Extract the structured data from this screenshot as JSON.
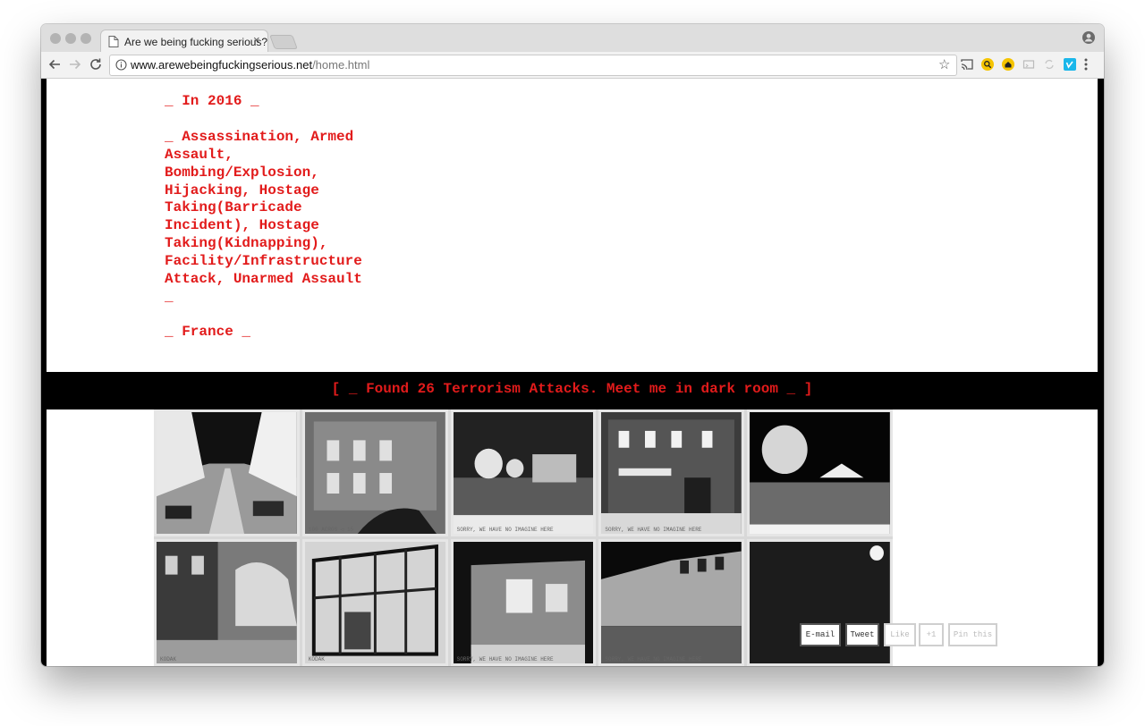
{
  "browser": {
    "tab_title": "Are we being fucking serious?",
    "tab_close": "×",
    "url_domain": "www.arewebeingfuckingserious.net",
    "url_path": "/home.html"
  },
  "page": {
    "year_line": "_ In 2016 _",
    "attack_types": "_ Assassination, Armed Assault, Bombing/Explosion, Hijacking, Hostage Taking(Barricade Incident), Hostage Taking(Kidnapping), Facility/Infrastructure Attack, Unarmed Assault _",
    "country_line": "_ France _",
    "banner": "[ _ Found 26 Terrorism Attacks. Meet me in dark room _ ]",
    "accent_color": "#e21b1b"
  },
  "gallery": {
    "captions": [
      "100 ACROS ◁ 15",
      "SORRY, WE HAVE NO IMAGINE HERE",
      "SORRY, WE HAVE NO IMAGINE HERE",
      "KODAK",
      "KODAK",
      "SORRY, WE HAVE NO IMAGINE HERE",
      "SORRY, WE HAVE NO IMAGINE HERE"
    ]
  },
  "share": {
    "email": "E-mail",
    "tweet": "Tweet",
    "like": "Like",
    "plus_one": "+1",
    "pin": "Pin this"
  }
}
